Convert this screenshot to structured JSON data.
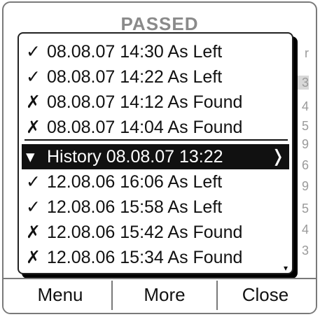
{
  "header": {
    "title": "PASSED"
  },
  "background_column": [
    {
      "text": "r"
    },
    {
      "text": "3"
    },
    {
      "text": "4"
    },
    {
      "text": "5"
    },
    {
      "text": "9"
    },
    {
      "text": "6"
    },
    {
      "text": "9"
    },
    {
      "text": "5"
    },
    {
      "text": "4"
    },
    {
      "text": "3"
    }
  ],
  "history_list": {
    "items": [
      {
        "icon": "check-icon",
        "glyph": "✓",
        "text": "08.08.07 14:30 As Left"
      },
      {
        "icon": "check-icon",
        "glyph": "✓",
        "text": "08.08.07 14:22 As Left"
      },
      {
        "icon": "cross-icon",
        "glyph": "✗",
        "text": "08.08.07 14:12 As Found"
      },
      {
        "icon": "cross-icon",
        "glyph": "✗",
        "text": "08.08.07 14:04 As Found"
      },
      {
        "icon": "history-icon",
        "glyph": "▾",
        "text": "History 08.08.07 13:22",
        "selected": true,
        "arrow": "❭"
      },
      {
        "icon": "check-icon",
        "glyph": "✓",
        "text": "12.08.06 16:06 As Left"
      },
      {
        "icon": "check-icon",
        "glyph": "✓",
        "text": "12.08.06 15:58 As Left"
      },
      {
        "icon": "cross-icon",
        "glyph": "✗",
        "text": "12.08.06 15:42 As Found"
      },
      {
        "icon": "cross-icon",
        "glyph": "✗",
        "text": "12.08.06 15:34 As Found"
      }
    ],
    "scroll_glyph": "▾"
  },
  "menu_bar": {
    "menu_label": "Menu",
    "more_label": "More",
    "close_label": "Close"
  },
  "colors": {
    "header_text": "#8a8a8a",
    "selected_bg": "#111111",
    "selected_text": "#ffffff",
    "frame": "#7a7a7a"
  }
}
